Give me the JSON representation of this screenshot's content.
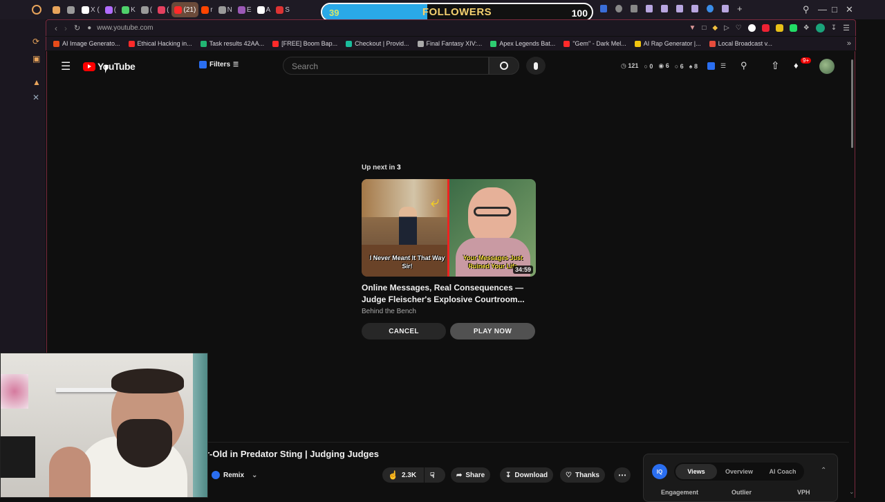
{
  "browser": {
    "tabs": [
      {
        "label": "",
        "color": "#e8a45b"
      },
      {
        "label": "",
        "color": "#9a9a9a"
      },
      {
        "label": "X (",
        "color": "#ffffff"
      },
      {
        "label": "(",
        "color": "#b16cff"
      },
      {
        "label": "K",
        "color": "#4fd06b"
      },
      {
        "label": "(",
        "color": "#9a9a9a"
      },
      {
        "label": "(",
        "color": "#e4405f"
      },
      {
        "label": "(21)",
        "color": "#ff2a2a",
        "active": true
      },
      {
        "label": "r",
        "color": "#ff4500"
      },
      {
        "label": "N",
        "color": "#9a9a9a"
      },
      {
        "label": "E",
        "color": "#9b59b6"
      },
      {
        "label": "A",
        "color": "#ffffff"
      },
      {
        "label": "S",
        "color": "#d33"
      }
    ],
    "followers_widget": {
      "current": "39",
      "label": "FOLLOWERS",
      "goal": "100",
      "progress_fraction": 0.39
    },
    "url": "www.youtube.com",
    "bookmarks": [
      {
        "label": "AI Image Generato...",
        "color": "#e84b1a"
      },
      {
        "label": "Ethical Hacking in...",
        "color": "#ff2a2a"
      },
      {
        "label": "Task results 42AA...",
        "color": "#22b573"
      },
      {
        "label": "[FREE] Boom Bap...",
        "color": "#ff2a2a"
      },
      {
        "label": "Checkout | Provid...",
        "color": "#1abc9c"
      },
      {
        "label": "Final Fantasy XIV:...",
        "color": "#aaaaaa"
      },
      {
        "label": "Apex Legends Bat...",
        "color": "#2ecc71"
      },
      {
        "label": "\"Gem\" - Dark Mel...",
        "color": "#ff2a2a"
      },
      {
        "label": "AI Rap Generator |...",
        "color": "#f1c40f"
      },
      {
        "label": "Local Broadcast v...",
        "color": "#e74c3c"
      }
    ]
  },
  "youtube": {
    "logo_text": "YouTube",
    "filters_label": "Filters",
    "search_placeholder": "Search",
    "stats": {
      "s1": "121",
      "s2": "0",
      "s3": "6",
      "s4": "6",
      "s5": "8"
    },
    "notif_badge": "9+",
    "up_next": {
      "prefix": "Up next in",
      "countdown": "3",
      "thumb_left_caption": "I Never Meant It That Way Sir!",
      "thumb_right_caption": "Your Messages Just Ruined Your Life",
      "duration": "34:59",
      "title": "Online Messages, Real Consequences — Judge Fleischer's Explosive Courtroom...",
      "channel": "Behind the Bench",
      "cancel_label": "CANCEL",
      "play_label": "PLAY NOW"
    },
    "video_title_partial": "r-Old in Predator Sting | Judging Judges",
    "actions": {
      "remix": "Remix",
      "likes": "2.3K",
      "share": "Share",
      "download": "Download",
      "thanks": "Thanks"
    },
    "iq_panel": {
      "badge": "IQ",
      "tabs": [
        "Views",
        "Overview",
        "AI Coach"
      ],
      "cols": [
        "Engagement",
        "Outlier",
        "VPH"
      ]
    }
  }
}
